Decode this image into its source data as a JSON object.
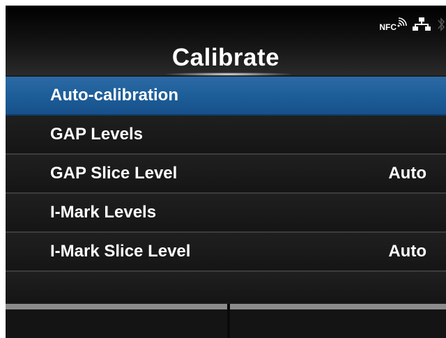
{
  "header": {
    "title": "Calibrate",
    "status_icons": [
      {
        "name": "nfc-icon",
        "text": "NFC"
      },
      {
        "name": "network-icon"
      },
      {
        "name": "bluetooth-icon"
      }
    ]
  },
  "menu": {
    "items": [
      {
        "label": "Auto-calibration",
        "value": "",
        "selected": true
      },
      {
        "label": "GAP Levels",
        "value": ""
      },
      {
        "label": "GAP Slice Level",
        "value": "Auto"
      },
      {
        "label": "I-Mark Levels",
        "value": ""
      },
      {
        "label": "I-Mark Slice Level",
        "value": "Auto"
      }
    ]
  },
  "softkeys": {
    "left": "",
    "right": ""
  },
  "colors": {
    "selection": "#1d5e99",
    "background": "#1b1b1b",
    "text": "#ffffff"
  }
}
